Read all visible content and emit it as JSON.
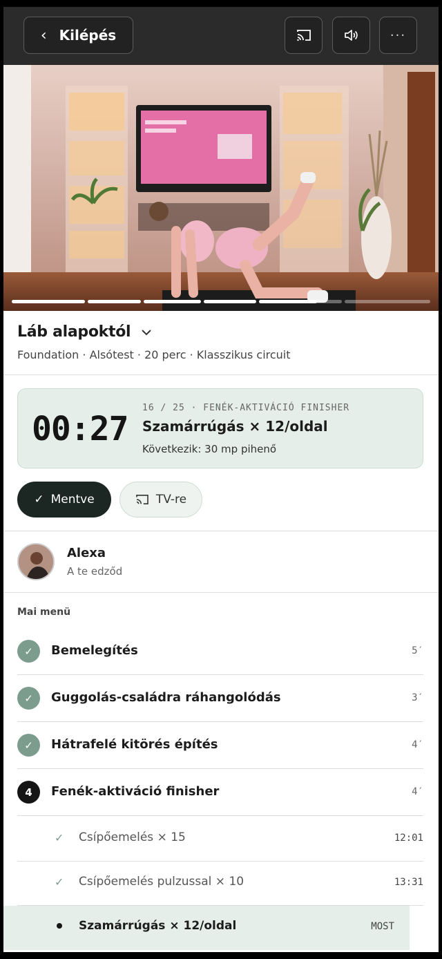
{
  "header": {
    "exit_label": "Kilépés",
    "icons": [
      "cast-icon",
      "volume-icon",
      "more-icon"
    ]
  },
  "video": {
    "progress_segments": [
      1,
      1,
      1,
      1,
      0.7,
      0
    ]
  },
  "workout": {
    "title": "Láb alapoktól",
    "meta": "Foundation · Alsótest · 20 perc · Klasszikus circuit"
  },
  "timer_card": {
    "time": "00:27",
    "step": "16 / 25 · FENÉK-AKTIVÁCIÓ FINISHER",
    "exercise": "Szamárrúgás × 12/oldal",
    "next": "Következik: 30 mp pihenő"
  },
  "actions": {
    "saved_label": "Mentve",
    "tv_label": "TV-re"
  },
  "coach": {
    "name": "Alexa",
    "role": "A te edződ"
  },
  "menu": {
    "title": "Mai menü",
    "sections": [
      {
        "badge": "✓",
        "label": "Bemelegítés",
        "duration": "5′",
        "state": "done"
      },
      {
        "badge": "✓",
        "label": "Guggolás-családra ráhangolódás",
        "duration": "3′",
        "state": "done"
      },
      {
        "badge": "✓",
        "label": "Hátrafelé kitörés építés",
        "duration": "4′",
        "state": "done"
      },
      {
        "badge": "4",
        "label": "Fenék-aktiváció finisher",
        "duration": "4′",
        "state": "current"
      }
    ],
    "items": [
      {
        "label": "Csípőemelés × 15",
        "time": "12:01",
        "state": "done"
      },
      {
        "label": "Csípőemelés pulzussal × 10",
        "time": "13:31",
        "state": "done"
      },
      {
        "label": "Szamárrúgás × 12/oldal",
        "time": "MOST",
        "state": "active"
      }
    ]
  },
  "colors": {
    "accent_green": "#7c9c8e",
    "card_bg": "#e5eee9",
    "dark": "#1c2622"
  }
}
